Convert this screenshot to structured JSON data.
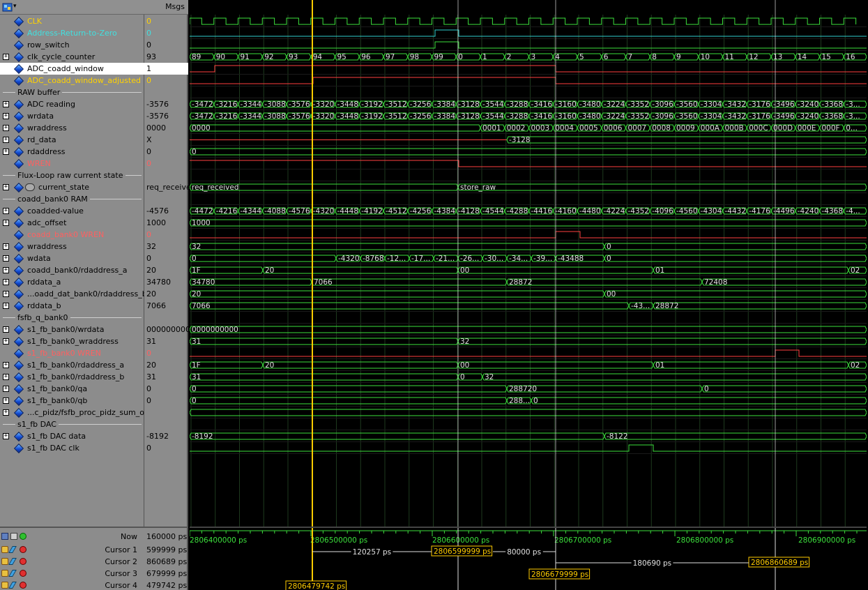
{
  "header": {
    "msgs_label": "Msgs"
  },
  "signals": [
    {
      "id": "clk",
      "name": "CLK",
      "value": "0",
      "color": "yellow",
      "expand": false,
      "kind": "signal"
    },
    {
      "id": "artz",
      "name": "Address-Return-to-Zero",
      "value": "0",
      "color": "cyan",
      "expand": false,
      "kind": "signal"
    },
    {
      "id": "row_switch",
      "name": "row_switch",
      "value": "0",
      "color": "normal",
      "expand": false,
      "kind": "signal"
    },
    {
      "id": "clk_cycle_counter",
      "name": "clk_cycle_counter",
      "value": "93",
      "color": "normal",
      "expand": true,
      "kind": "signal"
    },
    {
      "id": "adc_coadd_window",
      "name": "ADC_coadd_window",
      "value": "1",
      "color": "normal",
      "expand": false,
      "kind": "signal",
      "selected": true
    },
    {
      "id": "adc_coadd_window_adjusted",
      "name": "ADC_coadd_window_adjusted",
      "value": "0",
      "color": "yellow",
      "expand": false,
      "kind": "signal"
    },
    {
      "id": "div_raw",
      "name": "RAW buffer",
      "kind": "divider"
    },
    {
      "id": "adc_reading",
      "name": "ADC reading",
      "value": "-3576",
      "color": "normal",
      "expand": true,
      "kind": "signal"
    },
    {
      "id": "wrdata",
      "name": "wrdata",
      "value": "-3576",
      "color": "normal",
      "expand": true,
      "kind": "signal"
    },
    {
      "id": "wraddress",
      "name": "wraddress",
      "value": "0000",
      "color": "normal",
      "expand": true,
      "kind": "signal"
    },
    {
      "id": "rd_data",
      "name": "rd_data",
      "value": "X",
      "color": "normal",
      "expand": true,
      "kind": "signal"
    },
    {
      "id": "rdaddress",
      "name": "rdaddress",
      "value": "0",
      "color": "normal",
      "expand": true,
      "kind": "signal"
    },
    {
      "id": "wren",
      "name": "WREN",
      "value": "0",
      "color": "red",
      "expand": false,
      "kind": "signal"
    },
    {
      "id": "div_flux",
      "name": "Flux-Loop raw current state",
      "kind": "divider"
    },
    {
      "id": "current_state",
      "name": "current_state",
      "value": "req_receive",
      "color": "normal",
      "expand": true,
      "kind": "state"
    },
    {
      "id": "div_coadd",
      "name": "coadd_bank0 RAM",
      "kind": "divider"
    },
    {
      "id": "coadded_value",
      "name": "coadded-value",
      "value": "-4576",
      "color": "normal",
      "expand": true,
      "kind": "signal"
    },
    {
      "id": "adc_offset",
      "name": "adc_offset",
      "value": "1000",
      "color": "normal",
      "expand": true,
      "kind": "signal"
    },
    {
      "id": "coadd_bank0_wren",
      "name": "coadd_bank0 WREN",
      "value": "0",
      "color": "red",
      "expand": false,
      "kind": "signal"
    },
    {
      "id": "wraddress2",
      "name": "wraddress",
      "value": "32",
      "color": "normal",
      "expand": true,
      "kind": "signal"
    },
    {
      "id": "wdata",
      "name": "wdata",
      "value": "0",
      "color": "normal",
      "expand": true,
      "kind": "signal"
    },
    {
      "id": "coadd_rdaddress_a",
      "name": "coadd_bank0/rdaddress_a",
      "value": "20",
      "color": "normal",
      "expand": true,
      "kind": "signal"
    },
    {
      "id": "rddata_a",
      "name": "rddata_a",
      "value": "34780",
      "color": "normal",
      "expand": true,
      "kind": "signal"
    },
    {
      "id": "coadd_rdaddress_b",
      "name": "...oadd_dat_bank0/rdaddress_b",
      "value": "20",
      "color": "normal",
      "expand": true,
      "kind": "signal"
    },
    {
      "id": "rddata_b",
      "name": "rddata_b",
      "value": "7066",
      "color": "normal",
      "expand": true,
      "kind": "signal"
    },
    {
      "id": "div_fsfb",
      "name": "fsfb_q_bank0",
      "kind": "divider"
    },
    {
      "id": "s1_wrdata",
      "name": "s1_fb_bank0/wrdata",
      "value": "0000000000",
      "color": "normal",
      "expand": true,
      "kind": "signal"
    },
    {
      "id": "s1_wraddress",
      "name": "s1_fb_bank0_wraddress",
      "value": "31",
      "color": "normal",
      "expand": true,
      "kind": "signal"
    },
    {
      "id": "s1_wren",
      "name": "s1_fb_bank0 WREN",
      "value": "0",
      "color": "red",
      "expand": false,
      "kind": "signal"
    },
    {
      "id": "s1_rdaddress_a",
      "name": "s1_fb_bank0/rdaddress_a",
      "value": "20",
      "color": "normal",
      "expand": true,
      "kind": "signal"
    },
    {
      "id": "s1_rdaddress_b",
      "name": "s1_fb_bank0/rdaddress_b",
      "value": "31",
      "color": "normal",
      "expand": true,
      "kind": "signal"
    },
    {
      "id": "s1_qa",
      "name": "s1_fb_bank0/qa",
      "value": "0",
      "color": "normal",
      "expand": true,
      "kind": "signal"
    },
    {
      "id": "s1_qb",
      "name": "s1_fb_bank0/qb",
      "value": "0",
      "color": "normal",
      "expand": true,
      "kind": "signal"
    },
    {
      "id": "pidz_sum",
      "name": "...c_pidz/fsfb_proc_pidz_sum_o",
      "value": "",
      "color": "normal",
      "expand": true,
      "kind": "signal"
    },
    {
      "id": "div_dac",
      "name": "s1_fb DAC",
      "kind": "divider"
    },
    {
      "id": "dac_data",
      "name": "s1_fb DAC data",
      "value": "-8192",
      "color": "normal",
      "expand": true,
      "kind": "signal"
    },
    {
      "id": "dac_clk",
      "name": "s1_fb DAC clk",
      "value": "0",
      "color": "normal",
      "expand": false,
      "kind": "signal"
    }
  ],
  "bus_labels": {
    "clk_cycle_counter": [
      "89",
      "90",
      "91",
      "92",
      "93",
      "94",
      "95",
      "96",
      "97",
      "98",
      "99",
      "0",
      "1",
      "2",
      "3",
      "4",
      "5",
      "6",
      "7",
      "8",
      "9",
      "10",
      "11",
      "12",
      "13",
      "14",
      "15",
      "16"
    ],
    "adc_reading": [
      "-3472",
      "-3216",
      "-3344",
      "-3088",
      "-3576",
      "-3320",
      "-3448",
      "-3192",
      "-3512",
      "-3256",
      "-3384",
      "-3128",
      "-3544",
      "-3288",
      "-3416",
      "-3160",
      "-3480",
      "-3224",
      "-3352",
      "-3096",
      "-3560",
      "-3304",
      "-3432",
      "-3176",
      "-3496",
      "-3240",
      "-3368",
      "-3..."
    ],
    "wrdata": [
      "-3472",
      "-3216",
      "-3344",
      "-3088",
      "-3576",
      "-3320",
      "-3448",
      "-3192",
      "-3512",
      "-3256",
      "-3384",
      "-3128",
      "-3544",
      "-3288",
      "-3416",
      "-3160",
      "-3480",
      "-3224",
      "-3352",
      "-3096",
      "-3560",
      "-3304",
      "-3432",
      "-3176",
      "-3496",
      "-3240",
      "-3368",
      "-3..."
    ],
    "wraddress": [
      "0000",
      "0001",
      "0002",
      "0003",
      "0004",
      "0005",
      "0006",
      "0007",
      "0008",
      "0009",
      "000A",
      "000B",
      "000C",
      "000D",
      "000E",
      "000F",
      "0..."
    ],
    "rd_data": [
      "-3128"
    ],
    "rdaddress": [
      "0"
    ],
    "current_state": [
      "req_received",
      "store_raw"
    ],
    "coadded_value": [
      "-4472",
      "-4216",
      "-4344",
      "-4088",
      "-4576",
      "-4320",
      "-4448",
      "-4192",
      "-4512",
      "-4256",
      "-4384",
      "-4128",
      "-4544",
      "-4288",
      "-4416",
      "-4160",
      "-4480",
      "-4224",
      "-4352",
      "-4096",
      "-4560",
      "-4304",
      "-4432",
      "-4176",
      "-4496",
      "-4240",
      "-4368",
      "-4..."
    ],
    "adc_offset": [
      "1000"
    ],
    "wraddress2": [
      "32",
      "0"
    ],
    "wdata": [
      "0",
      "-4320",
      "-8768",
      "-12...",
      "-17...",
      "-21...",
      "-26...",
      "-30...",
      "-34...",
      "-39...",
      "-43488",
      "0"
    ],
    "coadd_rdaddress_a": [
      "1F",
      "20",
      "00",
      "01",
      "02"
    ],
    "rddata_a": [
      "34780",
      "7066",
      "28872",
      "72408"
    ],
    "coadd_rdaddress_b": [
      "20",
      "00"
    ],
    "rddata_b": [
      "7066",
      "-43...",
      "28872"
    ],
    "s1_wrdata": [
      "0000000000"
    ],
    "s1_wraddress": [
      "31",
      "32"
    ],
    "s1_rdaddress_a": [
      "1F",
      "20",
      "00",
      "01",
      "02"
    ],
    "s1_rdaddress_b": [
      "31",
      "0",
      "32"
    ],
    "s1_qa": [
      "0",
      "288720",
      "0"
    ],
    "s1_qb": [
      "0",
      "288...",
      "0"
    ],
    "dac_data": [
      "-8192",
      "-8122"
    ]
  },
  "cursor_panel": {
    "now_label": "Now",
    "now_value": "160000 ps",
    "cursors": [
      {
        "name": "Cursor 1",
        "value": "599999 ps"
      },
      {
        "name": "Cursor 2",
        "value": "860689 ps"
      },
      {
        "name": "Cursor 3",
        "value": "679999 ps"
      },
      {
        "name": "Cursor 4",
        "value": "479742 ps"
      }
    ]
  },
  "timeline": {
    "labels": [
      "2806400000 ps",
      "2806500000 ps",
      "2806600000 ps",
      "2806700000 ps",
      "2806800000 ps",
      "2806900000 ps"
    ],
    "cursor_readouts": [
      "2806599999 ps",
      "2806860689 ps",
      "2806679999 ps",
      "2806479742 ps"
    ],
    "deltas": [
      "120257 ps",
      "80000 ps",
      "180690 ps"
    ]
  },
  "colors": {
    "wave_green": "#3ce03c",
    "wave_red": "#ff4040",
    "wave_cyan": "#30d0d0",
    "cursor_yellow": "#ffcc00",
    "cursor_white": "#e0e0e0",
    "grid": "#1e3a1e"
  }
}
